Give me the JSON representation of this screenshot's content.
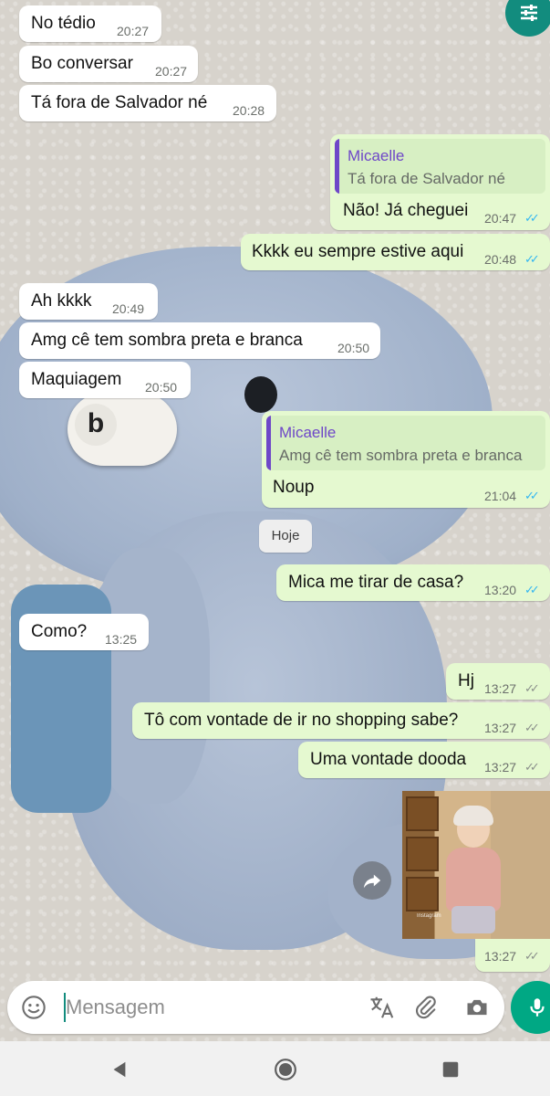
{
  "messages": [
    {
      "dir": "in",
      "text": "No tédio",
      "time": "20:27"
    },
    {
      "dir": "in",
      "text": "Bo conversar",
      "time": "20:27"
    },
    {
      "dir": "in",
      "text": "Tá fora de Salvador né",
      "time": "20:28"
    },
    {
      "dir": "out",
      "quote_name": "Micaelle",
      "quote_text": "Tá fora de Salvador né",
      "text": "Não! Já cheguei",
      "time": "20:47",
      "status": "read"
    },
    {
      "dir": "out",
      "text": "Kkkk eu sempre estive aqui",
      "time": "20:48",
      "status": "read"
    },
    {
      "dir": "in",
      "text": "Ah kkkk",
      "time": "20:49"
    },
    {
      "dir": "in",
      "text": "Amg cê tem sombra preta e branca",
      "time": "20:50"
    },
    {
      "dir": "in",
      "text": "Maquiagem",
      "time": "20:50"
    },
    {
      "dir": "out",
      "quote_name": "Micaelle",
      "quote_text": "Amg cê tem sombra preta e branca",
      "text": "Noup",
      "time": "21:04",
      "status": "read"
    },
    {
      "dir": "out",
      "text": "Mica me tirar de casa?",
      "time": "13:20",
      "status": "read"
    },
    {
      "dir": "in",
      "text": "Como?",
      "time": "13:25"
    },
    {
      "dir": "out",
      "text": "Hj",
      "time": "13:27",
      "status": "delivered"
    },
    {
      "dir": "out",
      "text": "Tô com vontade de ir no shopping sabe?",
      "time": "13:27",
      "status": "delivered"
    },
    {
      "dir": "out",
      "text": "Uma vontade dooda",
      "time": "13:27",
      "status": "delivered"
    },
    {
      "dir": "out",
      "type": "image",
      "time": "13:27",
      "status": "delivered"
    }
  ],
  "date_divider": "Hoje",
  "image_watermark": "Instagram",
  "composer": {
    "placeholder": "Mensagem"
  },
  "icons": {
    "filter": "sliders-icon",
    "emoji": "emoji-icon",
    "translate": "translate-icon",
    "attach": "paperclip-icon",
    "camera": "camera-icon",
    "mic": "microphone-icon",
    "share": "forward-icon",
    "back": "back-triangle-icon",
    "home": "home-circle-icon",
    "recents": "recents-square-icon"
  },
  "colors": {
    "outgoing": "#e5f9d0",
    "incoming": "#ffffff",
    "read_tick": "#34b7f1",
    "accent": "#00a884",
    "quote_name": "#6e47c8"
  }
}
